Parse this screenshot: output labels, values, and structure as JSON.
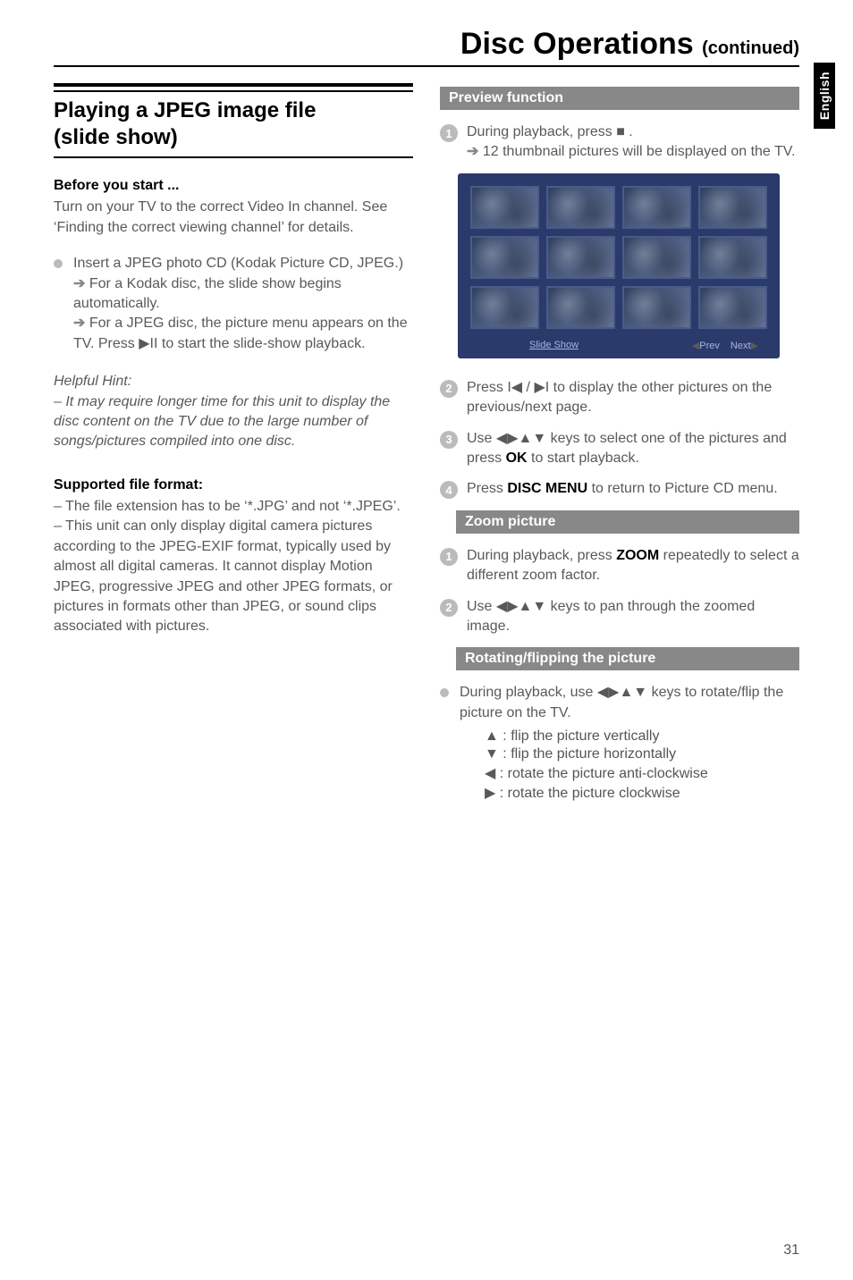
{
  "side_tab": "English",
  "main_title": "Disc Operations",
  "main_title_cont": "(continued)",
  "left": {
    "section_title_l1": "Playing a JPEG image file",
    "section_title_l2": "(slide show)",
    "before_heading": "Before you start ...",
    "before_text": "Turn on your TV to the correct Video In channel.  See ‘Finding the correct viewing channel’ for details.",
    "insert_text": "Insert a JPEG photo CD (Kodak Picture CD, JPEG.)",
    "kodak_arrow": "For a Kodak disc, the slide show begins automatically.",
    "jpeg_arrow_pre": "For a JPEG disc, the picture menu appears on the TV.  Press ",
    "jpeg_arrow_post": " to start the slide-show playback.",
    "hint_label": "Helpful Hint:",
    "hint_text": "–  It may require longer time for this unit to display the disc content on the TV due to the large number of songs/pictures compiled into one disc.",
    "supported_heading": "Supported file format:",
    "supported_p1": "–  The file extension has to be ‘*.JPG’ and not ‘*.JPEG’.",
    "supported_p2": "–  This unit can only display digital camera pictures according to the JPEG-EXIF format, typically used by almost all digital cameras.  It cannot display Motion JPEG, progressive JPEG and other JPEG formats, or pictures in formats other than JPEG, or sound clips associated with pictures."
  },
  "right": {
    "preview_header": "Preview function",
    "step1_pre": "During playback, press ",
    "step1_post": " .",
    "step1_arrow": "12 thumbnail pictures will be displayed on the TV.",
    "thumb_slide": "Slide Show",
    "thumb_prev": "Prev",
    "thumb_next": "Next",
    "step2_pre": "Press ",
    "step2_post": " to display the other pictures on the previous/next page.",
    "step3_pre": "Use ",
    "step3_mid": " keys to select one of the pictures and press ",
    "step3_ok": "OK",
    "step3_post": " to start playback.",
    "step4_pre": "Press ",
    "step4_menu": "DISC MENU",
    "step4_post": " to return to Picture CD menu.",
    "zoom_header": "Zoom picture",
    "zoom1_pre": "During playback, press ",
    "zoom1_zoom": "ZOOM",
    "zoom1_post": " repeatedly to select a different zoom factor.",
    "zoom2_pre": "Use ",
    "zoom2_post": " keys to pan through the zoomed image.",
    "rotate_header": "Rotating/flipping the picture",
    "rotate_bullet_pre": "During playback, use ",
    "rotate_bullet_post": " keys to rotate/flip the picture on the TV.",
    "k_up": ": flip the picture vertically",
    "k_down": ": flip the picture horizontally",
    "k_left": ": rotate the picture anti-clockwise",
    "k_right": ": rotate the picture clockwise"
  },
  "page_number": "31"
}
